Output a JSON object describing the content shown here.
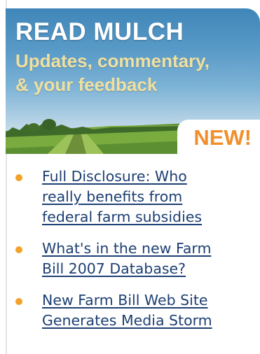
{
  "banner": {
    "title": "READ MULCH",
    "subtitle_line1": "Updates, commentary,",
    "subtitle_line2": "& your feedback",
    "badge": "NEW!"
  },
  "news": [
    {
      "line1": "Full Disclosure: Who",
      "line2": "really benefits from",
      "line3": "federal farm subsidies"
    },
    {
      "line1": "What's in the new Farm",
      "line2": "Bill 2007 Database?"
    },
    {
      "line1": "New Farm Bill Web Site",
      "line2": "Generates Media Storm"
    }
  ],
  "colors": {
    "link": "#1d3f73",
    "bullet": "#f3a22a",
    "badge_text": "#f18f2c",
    "banner_title": "#ffffff",
    "banner_subtitle": "#f0e0a0"
  }
}
